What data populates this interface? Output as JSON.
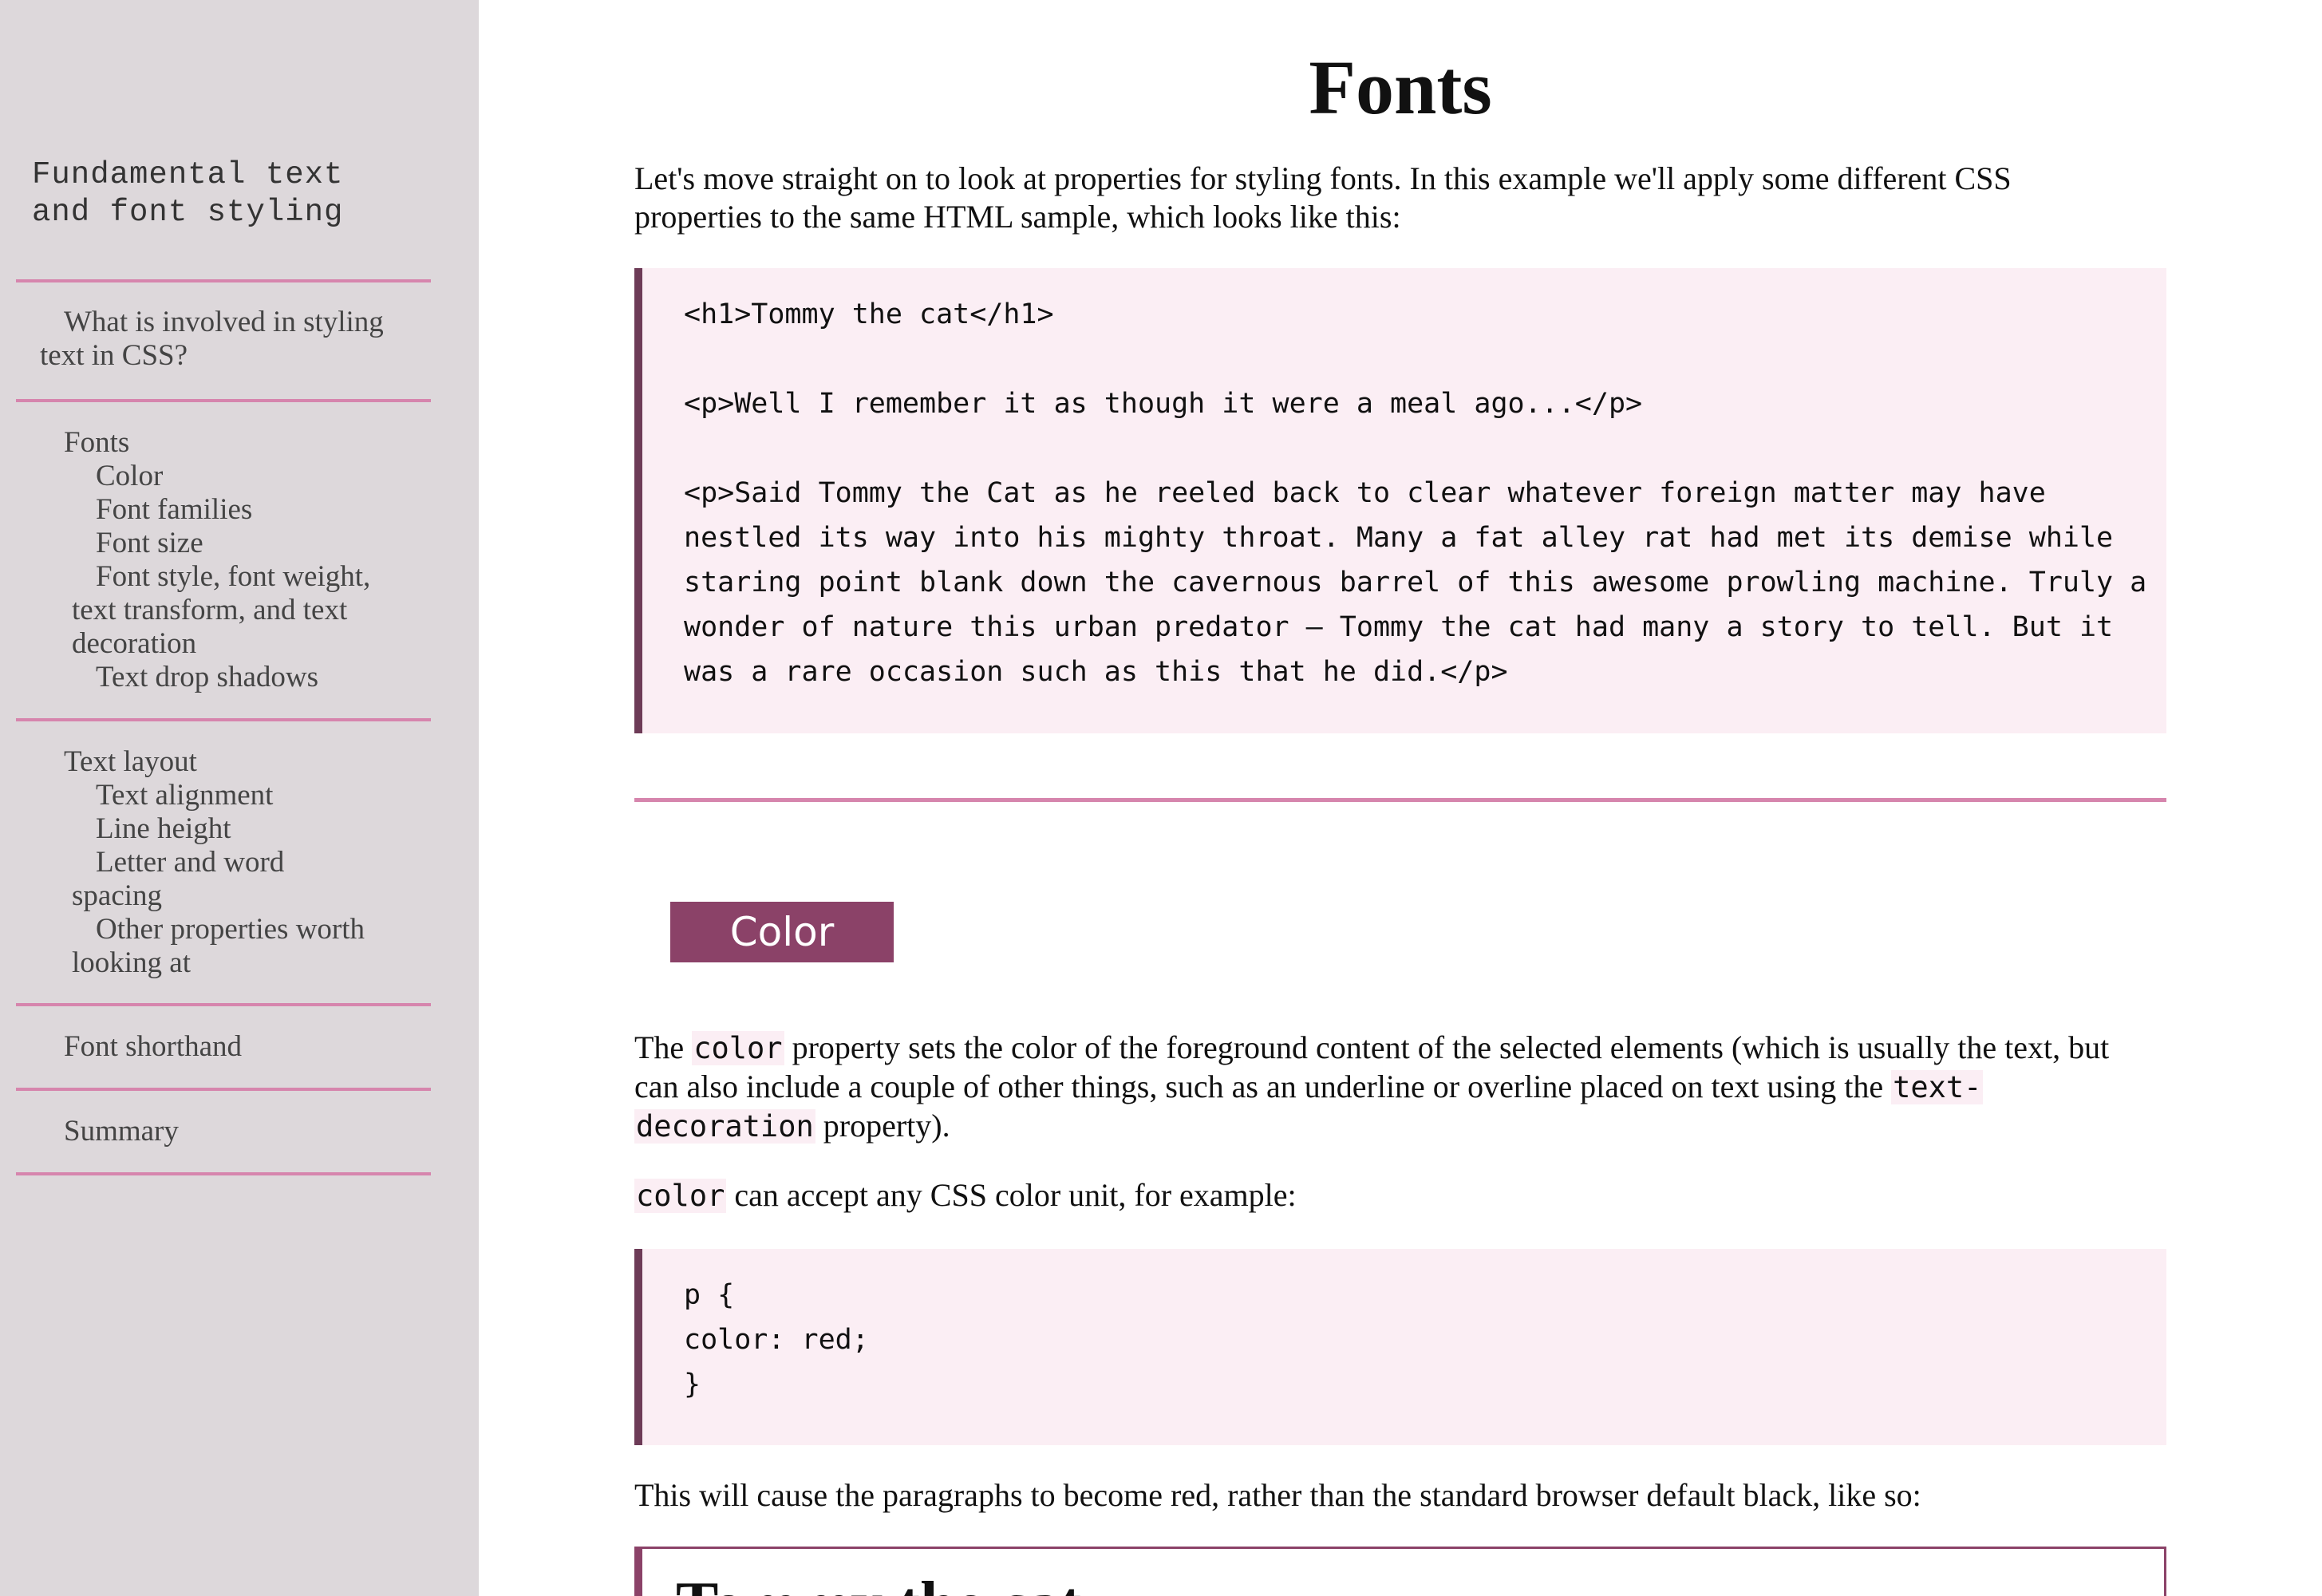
{
  "sidebar": {
    "title_line1": "Fundamental text",
    "title_line2": "and font styling",
    "items": [
      {
        "line1": "What is involved in styling",
        "line2": "text in CSS?"
      },
      {
        "label": "Fonts"
      },
      {
        "label": "Color"
      },
      {
        "label": "Font families"
      },
      {
        "label": "Font size"
      },
      {
        "line1": "Font style, font weight,",
        "line2": "text transform, and text",
        "line3": "decoration"
      },
      {
        "label": "Text drop shadows"
      },
      {
        "label": "Text layout"
      },
      {
        "label": "Text alignment"
      },
      {
        "label": "Line height"
      },
      {
        "line1": "Letter and word",
        "line2": "spacing"
      },
      {
        "line1": "Other properties worth",
        "line2": "looking at"
      },
      {
        "label": "Font shorthand"
      },
      {
        "label": "Summary"
      }
    ]
  },
  "main": {
    "title": "Fonts",
    "intro_line1": "Let's move straight on to look at properties for styling fonts. In this example we'll apply some different CSS",
    "intro_line2": "properties to the same HTML sample, which looks like this:",
    "code1": [
      "<h1>Tommy the cat</h1>",
      "",
      "<p>Well I remember it as though it were a meal ago...</p>",
      "",
      "<p>Said Tommy the Cat as he reeled back to clear whatever foreign matter may have",
      "nestled its way into his mighty throat. Many a fat alley rat had met its demise while",
      "staring point blank down the cavernous barrel of this awesome prowling machine. Truly a",
      "wonder of nature this urban predator — Tommy the cat had many a story to tell. But it",
      "was a rare occasion such as this that he did.</p>"
    ],
    "color_heading": "Color",
    "color_para": {
      "p1_a": "The ",
      "p1_code1": "color",
      "p1_b": " property sets the color of the foreground content of the selected elements (which is usually the text, but",
      "p2_a": "can also include a couple of other things, such as an underline or overline placed on text using the ",
      "p2_code": "text-",
      "p3_code": "decoration",
      "p3_b": " property)."
    },
    "color_units": {
      "code": "color",
      "text": " can accept any CSS color unit, for example:"
    },
    "code2": [
      "p {",
      "color: red;",
      "}"
    ],
    "result_intro": "This will cause the paragraphs to become red, rather than the standard browser default black, like so:",
    "result_heading": "Tommy the cat"
  }
}
